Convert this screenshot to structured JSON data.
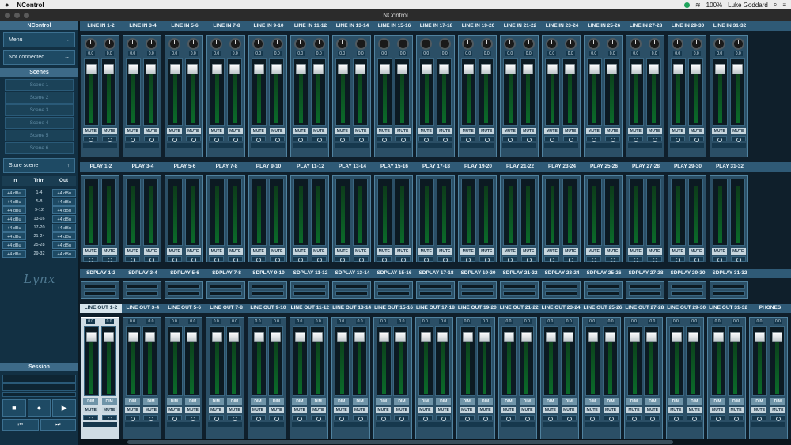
{
  "menubar": {
    "app_name": "NControl",
    "user": "Luke Goddard",
    "battery": "100%",
    "colors": {
      "sync": "#1fa35c"
    }
  },
  "window": {
    "title": "NControl"
  },
  "sidebar": {
    "header": "NControl",
    "menu_label": "Menu",
    "connection_label": "Not connected",
    "scenes_header": "Scenes",
    "scenes": [
      "Scene 1",
      "Scene 2",
      "Scene 3",
      "Scene 4",
      "Scene 5",
      "Scene 6"
    ],
    "store_label": "Store scene",
    "trim_headers": {
      "in": "In",
      "trim": "Trim",
      "out": "Out"
    },
    "trim_rows": [
      {
        "in": "+4 dBu",
        "ch": "1-4",
        "out": "+4 dBu"
      },
      {
        "in": "+4 dBu",
        "ch": "5-8",
        "out": "+4 dBu"
      },
      {
        "in": "+4 dBu",
        "ch": "9-12",
        "out": "+4 dBu"
      },
      {
        "in": "+4 dBu",
        "ch": "13-16",
        "out": "+4 dBu"
      },
      {
        "in": "+4 dBu",
        "ch": "17-20",
        "out": "+4 dBu"
      },
      {
        "in": "+4 dBu",
        "ch": "21-24",
        "out": "+4 dBu"
      },
      {
        "in": "+4 dBu",
        "ch": "25-28",
        "out": "+4 dBu"
      },
      {
        "in": "+4 dBu",
        "ch": "29-32",
        "out": "+4 dBu"
      }
    ],
    "logo": "Lynx",
    "session_header": "Session"
  },
  "sections": {
    "line_in": {
      "labels": [
        "LINE IN 1-2",
        "LINE IN 3-4",
        "LINE IN 5-6",
        "LINE IN 7-8",
        "LINE IN 9-10",
        "LINE IN 11-12",
        "LINE IN 13-14",
        "LINE IN 15-16",
        "LINE IN 17-18",
        "LINE IN 19-20",
        "LINE IN 21-22",
        "LINE IN 23-24",
        "LINE IN 25-26",
        "LINE IN 27-28",
        "LINE IN 29-30",
        "LINE IN 31-32"
      ],
      "knob_value": "0.0",
      "mute": "MUTE",
      "pan": "-"
    },
    "play": {
      "labels": [
        "PLAY 1-2",
        "PLAY 3-4",
        "PLAY 5-6",
        "PLAY 7-8",
        "PLAY 9-10",
        "PLAY 11-12",
        "PLAY 13-14",
        "PLAY 15-16",
        "PLAY 17-18",
        "PLAY 19-20",
        "PLAY 21-22",
        "PLAY 23-24",
        "PLAY 25-26",
        "PLAY 27-28",
        "PLAY 29-30",
        "PLAY 31-32"
      ],
      "mute": "MUTE"
    },
    "sdplay": {
      "labels": [
        "SDPLAY 1-2",
        "SDPLAY 3-4",
        "SDPLAY 5-6",
        "SDPLAY 7-8",
        "SDPLAY 9-10",
        "SDPLAY 11-12",
        "SDPLAY 13-14",
        "SDPLAY 15-16",
        "SDPLAY 17-18",
        "SDPLAY 19-20",
        "SDPLAY 21-22",
        "SDPLAY 23-24",
        "SDPLAY 25-26",
        "SDPLAY 27-28",
        "SDPLAY 29-30",
        "SDPLAY 31-32"
      ]
    },
    "line_out": {
      "labels": [
        "LINE OUT 1-2",
        "LINE OUT 3-4",
        "LINE OUT 5-6",
        "LINE OUT 7-8",
        "LINE OUT 9-10",
        "LINE OUT 11-12",
        "LINE OUT 13-14",
        "LINE OUT 15-16",
        "LINE OUT 17-18",
        "LINE OUT 19-20",
        "LINE OUT 21-22",
        "LINE OUT 23-24",
        "LINE OUT 25-26",
        "LINE OUT 27-28",
        "LINE OUT 29-30",
        "LINE OUT 31-32",
        "PHONES"
      ],
      "value": "0.0",
      "dim": "DIM",
      "mute": "MUTE",
      "pan": "-",
      "selected_index": 0
    }
  },
  "transport": {
    "stop": "■",
    "record": "●",
    "play": "▶",
    "prev": "⏮",
    "next": "⏭"
  }
}
